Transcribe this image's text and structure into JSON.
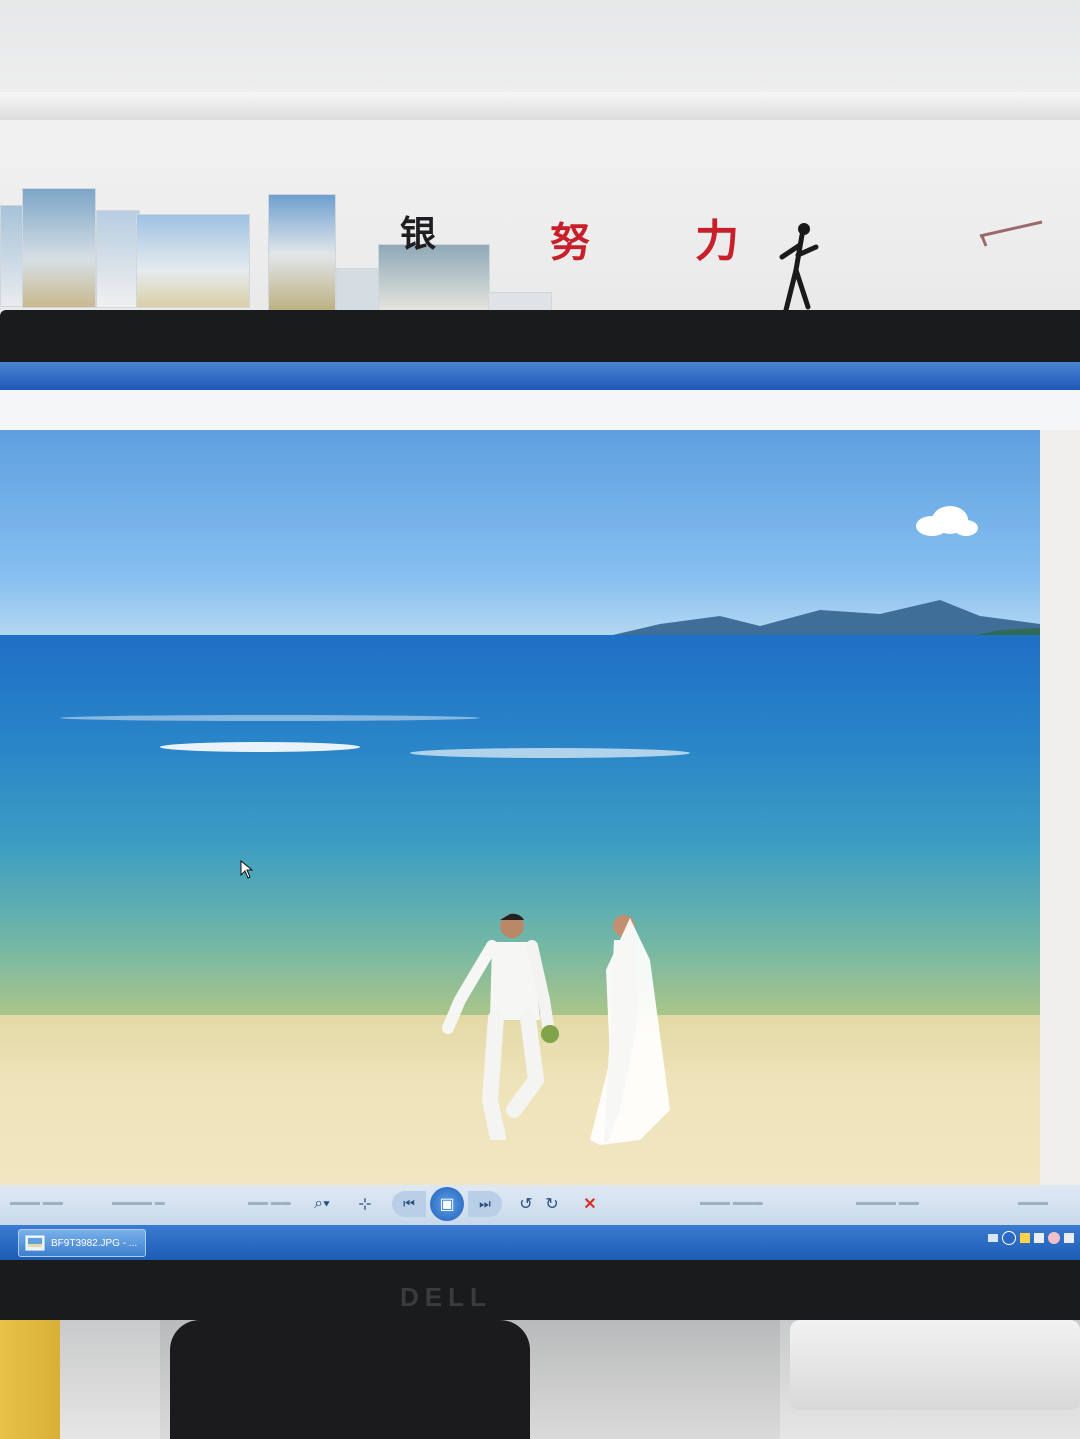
{
  "wall": {
    "characters": [
      "银",
      "努",
      "力"
    ]
  },
  "window": {
    "toolbar_buttons": [
      {
        "name": "zoom",
        "glyph": "⌕▾"
      },
      {
        "name": "fit",
        "glyph": "⊹"
      },
      {
        "name": "previous",
        "glyph": "⏮"
      },
      {
        "name": "slideshow",
        "glyph": "▣"
      },
      {
        "name": "next",
        "glyph": "⏭"
      },
      {
        "name": "rotate-ccw",
        "glyph": "↺"
      },
      {
        "name": "rotate-cw",
        "glyph": "↻"
      },
      {
        "name": "delete",
        "glyph": "✕"
      }
    ]
  },
  "taskbar": {
    "active_task": "BF9T3982.JPG - ..."
  },
  "monitor": {
    "brand": "DELL"
  },
  "colors": {
    "accent_blue": "#1f56b8",
    "delete_red": "#d8322f"
  }
}
